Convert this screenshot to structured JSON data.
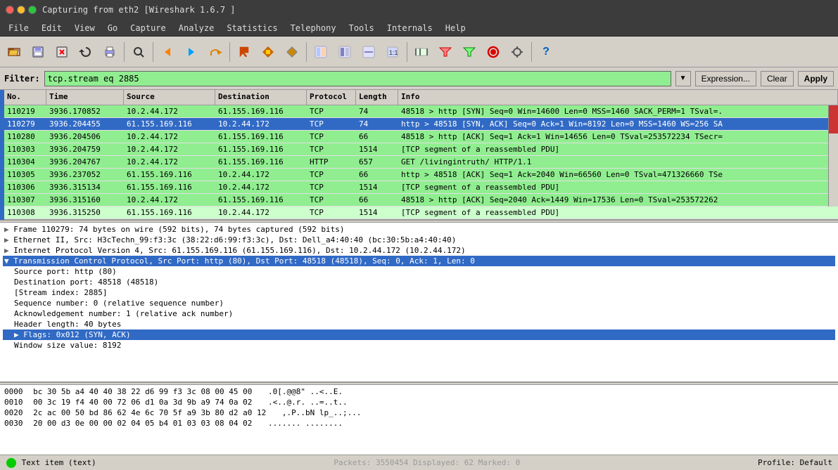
{
  "titlebar": {
    "title": "Capturing from eth2   [Wireshark 1.6.7 ]"
  },
  "menu": {
    "items": [
      "File",
      "Edit",
      "View",
      "Go",
      "Capture",
      "Analyze",
      "Statistics",
      "Telephony",
      "Tools",
      "Internals",
      "Help"
    ]
  },
  "filter": {
    "label": "Filter:",
    "value": "tcp.stream eq 2885",
    "expression_btn": "Expression...",
    "clear_btn": "Clear",
    "apply_btn": "Apply"
  },
  "packet_columns": [
    "No.",
    "Time",
    "Source",
    "Destination",
    "Protocol",
    "Length",
    "Info"
  ],
  "packets": [
    {
      "no": "110219",
      "time": "3936.170852",
      "src": "10.2.44.172",
      "dst": "61.155.169.116",
      "proto": "TCP",
      "len": "74",
      "info": "48518 > http [SYN] Seq=0 Win=14600 Len=0 MSS=1460 SACK_PERM=1 TSval=.",
      "color": "green"
    },
    {
      "no": "110279",
      "time": "3936.204455",
      "src": "61.155.169.116",
      "dst": "10.2.44.172",
      "proto": "TCP",
      "len": "74",
      "info": "http > 48518 [SYN, ACK] Seq=0 Ack=1 Win=8192 Len=0 MSS=1460 WS=256 SA",
      "color": "green"
    },
    {
      "no": "110280",
      "time": "3936.204506",
      "src": "10.2.44.172",
      "dst": "61.155.169.116",
      "proto": "TCP",
      "len": "66",
      "info": "48518 > http [ACK] Seq=1 Ack=1 Win=14656 Len=0 TSval=253572234 TSecr=",
      "color": "green"
    },
    {
      "no": "110303",
      "time": "3936.204759",
      "src": "10.2.44.172",
      "dst": "61.155.169.116",
      "proto": "TCP",
      "len": "1514",
      "info": "[TCP segment of a reassembled PDU]",
      "color": "green"
    },
    {
      "no": "110304",
      "time": "3936.204767",
      "src": "10.2.44.172",
      "dst": "61.155.169.116",
      "proto": "HTTP",
      "len": "657",
      "info": "GET /livingintruth/ HTTP/1.1",
      "color": "green"
    },
    {
      "no": "110305",
      "time": "3936.237052",
      "src": "61.155.169.116",
      "dst": "10.2.44.172",
      "proto": "TCP",
      "len": "66",
      "info": "http > 48518 [ACK] Seq=1 Ack=2040 Win=66560 Len=0 TSval=471326660 TSe",
      "color": "green"
    },
    {
      "no": "110306",
      "time": "3936.315134",
      "src": "61.155.169.116",
      "dst": "10.2.44.172",
      "proto": "TCP",
      "len": "1514",
      "info": "[TCP segment of a reassembled PDU]",
      "color": "green"
    },
    {
      "no": "110307",
      "time": "3936.315160",
      "src": "10.2.44.172",
      "dst": "61.155.169.116",
      "proto": "TCP",
      "len": "66",
      "info": "48518 > http [ACK] Seq=2040 Ack=1449 Win=17536 Len=0 TSval=253572262",
      "color": "green"
    },
    {
      "no": "110308",
      "time": "3936.315250",
      "src": "61.155.169.116",
      "dst": "10.2.44.172",
      "proto": "TCP",
      "len": "1514",
      "info": "[TCP segment of a reassembled PDU]",
      "color": "light-green"
    }
  ],
  "detail": {
    "lines": [
      {
        "text": "Frame 110279: 74 bytes on wire (592 bits), 74 bytes captured (592 bits)",
        "indent": 0,
        "expandable": true,
        "selected": false
      },
      {
        "text": "Ethernet II, Src: H3cTechn_99:f3:3c (38:22:d6:99:f3:3c), Dst: Dell_a4:40:40 (bc:30:5b:a4:40:40)",
        "indent": 0,
        "expandable": true,
        "selected": false
      },
      {
        "text": "Internet Protocol Version 4, Src: 61.155.169.116 (61.155.169.116), Dst: 10.2.44.172 (10.2.44.172)",
        "indent": 0,
        "expandable": true,
        "selected": false
      },
      {
        "text": "Transmission Control Protocol, Src Port: http (80), Dst Port: 48518 (48518), Seq: 0, Ack: 1, Len: 0",
        "indent": 0,
        "expandable": true,
        "selected": true
      },
      {
        "text": "Source port: http (80)",
        "indent": 1,
        "expandable": false,
        "selected": false
      },
      {
        "text": "Destination port: 48518 (48518)",
        "indent": 1,
        "expandable": false,
        "selected": false
      },
      {
        "text": "[Stream index: 2885]",
        "indent": 1,
        "expandable": false,
        "selected": false
      },
      {
        "text": "Sequence number: 0    (relative sequence number)",
        "indent": 1,
        "expandable": false,
        "selected": false
      },
      {
        "text": "Acknowledgement number: 1    (relative ack number)",
        "indent": 1,
        "expandable": false,
        "selected": false
      },
      {
        "text": "Header length: 40 bytes",
        "indent": 1,
        "expandable": false,
        "selected": false
      },
      {
        "text": "Flags: 0x012 (SYN, ACK)",
        "indent": 1,
        "expandable": true,
        "selected": true
      },
      {
        "text": "Window size value: 8192",
        "indent": 1,
        "expandable": false,
        "selected": false
      }
    ]
  },
  "hex": {
    "lines": [
      {
        "offset": "0000",
        "hex": "bc 30 5b a4 40 40 38 22   d6 99 f3 3c 08 00 45 00",
        "ascii": ".0[.@@8\" ...<..E."
      },
      {
        "offset": "0010",
        "hex": "00 3c 19 f4 40 00 72 06   d1 0a 3d 9b a9 74 0a 02",
        "ascii": ".<..@.r. ..=..t.."
      },
      {
        "offset": "0020",
        "hex": "2c ac 00 50 bd 86 62 4e   6c 70 5f a9 3b 80 d2 a0 12",
        "ascii": ",.P..bN lp_..;..."
      },
      {
        "offset": "0030",
        "hex": "20 00 d3 0e 00 00 02 04   05 b4 01 03 03 08 04 02",
        "ascii": " ....... ........"
      }
    ]
  },
  "statusbar": {
    "left": "Text item (text)",
    "center": "Packets: 3550454  Displayed: 62  Marked: 0",
    "right": "Profile: Default"
  },
  "toolbar_icons": {
    "open": "📂",
    "save": "💾",
    "close": "✖",
    "reload": "🔄",
    "print": "🖨",
    "find": "🔍",
    "back": "◀",
    "forward": "▶",
    "goto": "↩",
    "capture": "⬇",
    "start": "🟢",
    "stop": "⬛",
    "restart": "🔃",
    "zoom_in": "🔎",
    "zoom_out": "🔍",
    "prefs": "⚙",
    "help": "?"
  }
}
